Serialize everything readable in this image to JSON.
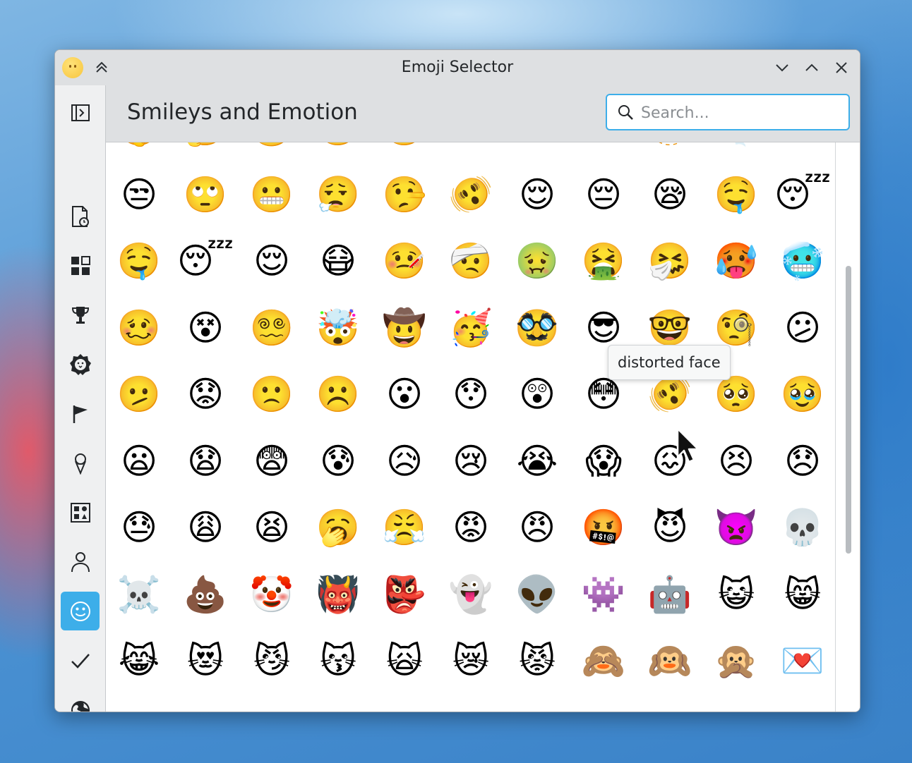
{
  "window": {
    "title": "Emoji Selector"
  },
  "header": {
    "title": "Smileys and Emotion"
  },
  "search": {
    "placeholder": "Search..."
  },
  "sidebar": {
    "categories": [
      {
        "name": "recent",
        "icon": "recent-document-icon"
      },
      {
        "name": "all",
        "icon": "grid-icon"
      },
      {
        "name": "activities",
        "icon": "trophy-icon"
      },
      {
        "name": "animals-and-nature",
        "icon": "lion-icon"
      },
      {
        "name": "flags",
        "icon": "flag-icon"
      },
      {
        "name": "food-and-drink",
        "icon": "ice-cream-icon"
      },
      {
        "name": "objects",
        "icon": "shapes-icon"
      },
      {
        "name": "people-and-body",
        "icon": "person-icon"
      },
      {
        "name": "smileys-and-emotion",
        "icon": "smiley-icon",
        "active": true
      },
      {
        "name": "symbols",
        "icon": "checkmark-icon"
      },
      {
        "name": "travel-and-places",
        "icon": "globe-icon"
      }
    ]
  },
  "emojis": [
    "🤫",
    "🤔",
    "🫡",
    "🤐",
    "🤨",
    "😐",
    "😑",
    "😶",
    "🫥",
    "😶‍🌫️",
    "😏",
    "😒",
    "🙄",
    "😬",
    "😮‍💨",
    "🤥",
    "🫨",
    "😌",
    "😔",
    "😪",
    "🤤",
    "😴",
    "🤤",
    "😴",
    "😌",
    "😷",
    "🤒",
    "🤕",
    "🤢",
    "🤮",
    "🤧",
    "🥵",
    "🥶",
    "🥴",
    "😵",
    "😵‍💫",
    "🤯",
    "🤠",
    "🥳",
    "🥸",
    "😎",
    "🤓",
    "🧐",
    "😕",
    "🫤",
    "😟",
    "🙁",
    "☹️",
    "😮",
    "😯",
    "😲",
    "😳",
    "🫨",
    "🥺",
    "🥹",
    "😦",
    "😧",
    "😨",
    "😰",
    "😥",
    "😢",
    "😭",
    "😱",
    "😖",
    "😣",
    "😞",
    "😓",
    "😩",
    "😫",
    "🥱",
    "😤",
    "😡",
    "😠",
    "🤬",
    "😈",
    "👿",
    "💀",
    "☠️",
    "💩",
    "🤡",
    "👹",
    "👺",
    "👻",
    "👽",
    "👾",
    "🤖",
    "😺",
    "😸",
    "😹",
    "😻",
    "😼",
    "😽",
    "🙀",
    "😿",
    "😾",
    "🙈",
    "🙉",
    "🙊",
    "💌"
  ],
  "selected_emoji_index": 52,
  "tooltip": {
    "text": "distorted face"
  }
}
